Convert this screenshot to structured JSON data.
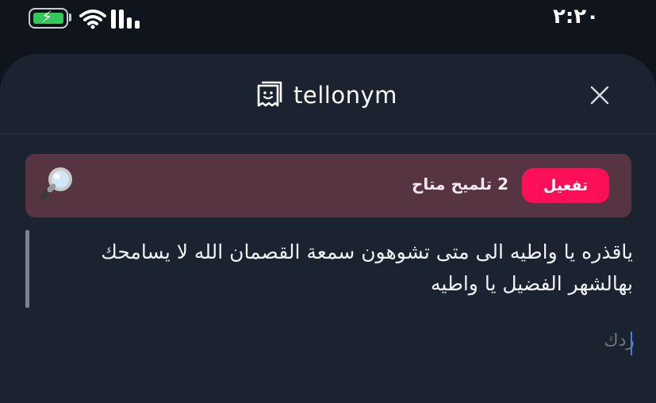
{
  "status_bar": {
    "time": "٢:٢٠",
    "battery_color": "#34c759",
    "icons": [
      "battery-charging-icon",
      "wifi-icon",
      "signal-icon"
    ]
  },
  "header": {
    "logo_text": "tellonym",
    "logo_icon": "tellonym-logo-icon",
    "close_icon": "close-icon"
  },
  "hint_banner": {
    "activate_label": "تفعيل",
    "hint_text": "2 تلميح متاح",
    "icon": "magnifier-icon",
    "accent": "#ff0f57",
    "background": "#563442"
  },
  "message": {
    "text": "ياقذره يا واطيه الى متى تشوهون سمعة القصمان الله لا يسامحك بهالشهر الفضيل يا واطيه"
  },
  "reply": {
    "placeholder": "ردك",
    "value": ""
  }
}
